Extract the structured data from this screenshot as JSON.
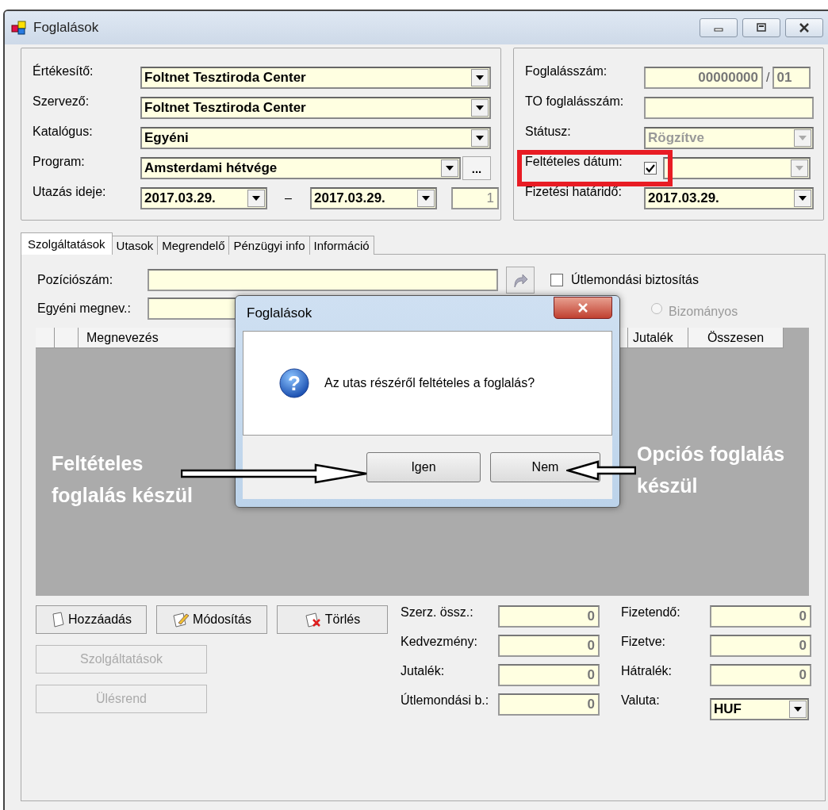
{
  "window": {
    "title": "Foglalások"
  },
  "booking_group": {
    "fields": [
      {
        "label": "Értékesítő:",
        "value": "Foltnet Tesztiroda Center",
        "kind": "combo"
      },
      {
        "label": "Szervező:",
        "value": "Foltnet Tesztiroda Center",
        "kind": "combo"
      },
      {
        "label": "Katalógus:",
        "value": "Egyéni",
        "kind": "combo"
      },
      {
        "label": "Program:",
        "value": "Amsterdami hétvége",
        "kind": "combo_browse",
        "browse": "..."
      },
      {
        "label": "Utazás ideje:",
        "kind": "date_range",
        "from": "2017.03.29.",
        "separator": "–",
        "to": "2017.03.29.",
        "days": "1"
      }
    ]
  },
  "booking_info": {
    "number": {
      "label": "Foglalásszám:",
      "value": "00000000",
      "separator": "/",
      "suffix": "01"
    },
    "to_number": {
      "label": "TO foglalásszám:"
    },
    "status": {
      "label": "Státusz:",
      "value": "Rögzítve",
      "disabled": true
    },
    "conditional_date": {
      "label": "Feltételes dátum:",
      "checked": true,
      "highlighted": true
    },
    "payment_deadline": {
      "label": "Fizetési határidő:",
      "value": "2017.03.29."
    }
  },
  "tabs": [
    {
      "label": "Szolgáltatások",
      "selected": true
    },
    {
      "label": "Utasok",
      "selected": false
    },
    {
      "label": "Megrendelő",
      "selected": false
    },
    {
      "label": "Pénzügyi info",
      "selected": false
    },
    {
      "label": "Információ",
      "selected": false
    }
  ],
  "services": {
    "position": {
      "label": "Pozíciószám:"
    },
    "cancellation_insurance": {
      "label": "Útlemondási biztosítás",
      "checked": false
    },
    "custom_name": {
      "label": "Egyéni megnev.:"
    },
    "commission_radio": {
      "label": "Bizományos",
      "selected": false,
      "disabled": true
    },
    "table": {
      "columns": [
        {
          "label": "Megnevezés"
        },
        {
          "label": "Jutalék"
        },
        {
          "label": "Összesen"
        }
      ]
    },
    "actions": [
      {
        "label": "Hozzáadás",
        "kind": "add",
        "disabled": false
      },
      {
        "label": "Módosítás",
        "kind": "edit",
        "disabled": false
      },
      {
        "label": "Törlés",
        "kind": "delete",
        "disabled": false
      }
    ],
    "secondary_actions": [
      {
        "label": "Szolgáltatások",
        "disabled": true
      },
      {
        "label": "Ülésrend",
        "disabled": true
      }
    ],
    "totals_left": [
      {
        "label": "Szerz. össz.:",
        "value": "0"
      },
      {
        "label": "Kedvezmény:",
        "value": "0"
      },
      {
        "label": "Jutalék:",
        "value": "0"
      },
      {
        "label": "Útlemondási b.:",
        "value": "0"
      }
    ],
    "totals_right": [
      {
        "label": "Fizetendő:",
        "value": "0",
        "kind": "number"
      },
      {
        "label": "Fizetve:",
        "value": "0",
        "kind": "number"
      },
      {
        "label": "Hátralék:",
        "value": "0",
        "kind": "number"
      },
      {
        "label": "Valuta:",
        "value": "HUF",
        "kind": "combo"
      }
    ]
  },
  "dialog": {
    "title": "Foglalások",
    "icon": "?",
    "message": "Az utas részéről feltételes a foglalás?",
    "buttons": [
      "Igen",
      "Nem"
    ]
  },
  "annotations": [
    {
      "text": "Feltételes foglalás készül",
      "kind": "left"
    },
    {
      "text": "Opciós foglalás készül",
      "kind": "right"
    }
  ]
}
